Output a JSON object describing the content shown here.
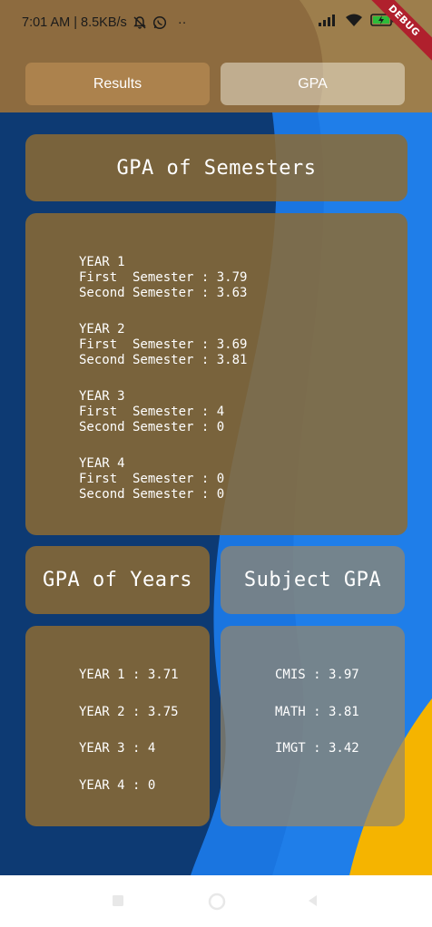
{
  "status_bar": {
    "time_speed": "7:01 AM | 8.5KB/s",
    "more_indicator": "··",
    "debug_label": "DEBUG"
  },
  "tabs": [
    {
      "label": "Results",
      "selected": false
    },
    {
      "label": "GPA",
      "selected": true
    }
  ],
  "semesters_card": {
    "title": "GPA of Semesters",
    "years": [
      {
        "year": "YEAR 1",
        "first": "First  Semester : 3.79",
        "second": "Second Semester : 3.63"
      },
      {
        "year": "YEAR 2",
        "first": "First  Semester : 3.69",
        "second": "Second Semester : 3.81"
      },
      {
        "year": "YEAR 3",
        "first": "First  Semester : 4",
        "second": "Second Semester : 0"
      },
      {
        "year": "YEAR 4",
        "first": "First  Semester : 0",
        "second": "Second Semester : 0"
      }
    ]
  },
  "years_card": {
    "title": "GPA of Years",
    "items": [
      "YEAR 1 : 3.71",
      "YEAR 2 : 3.75",
      "YEAR 3 : 4",
      "YEAR 4 : 0"
    ]
  },
  "subjects_card": {
    "title": "Subject GPA",
    "items": [
      "CMIS : 3.97",
      "MATH : 3.81",
      "IMGT : 3.42"
    ]
  },
  "nav_bar": {
    "icons": [
      "recent-apps-icon",
      "home-icon",
      "back-icon"
    ]
  },
  "colors": {
    "background_dark_blue": "#0d3a73",
    "background_light_blue": "#1976e3",
    "accent_yellow": "#f5b400",
    "card_brown": "#8d6b33",
    "debug_red": "#b0202d"
  }
}
